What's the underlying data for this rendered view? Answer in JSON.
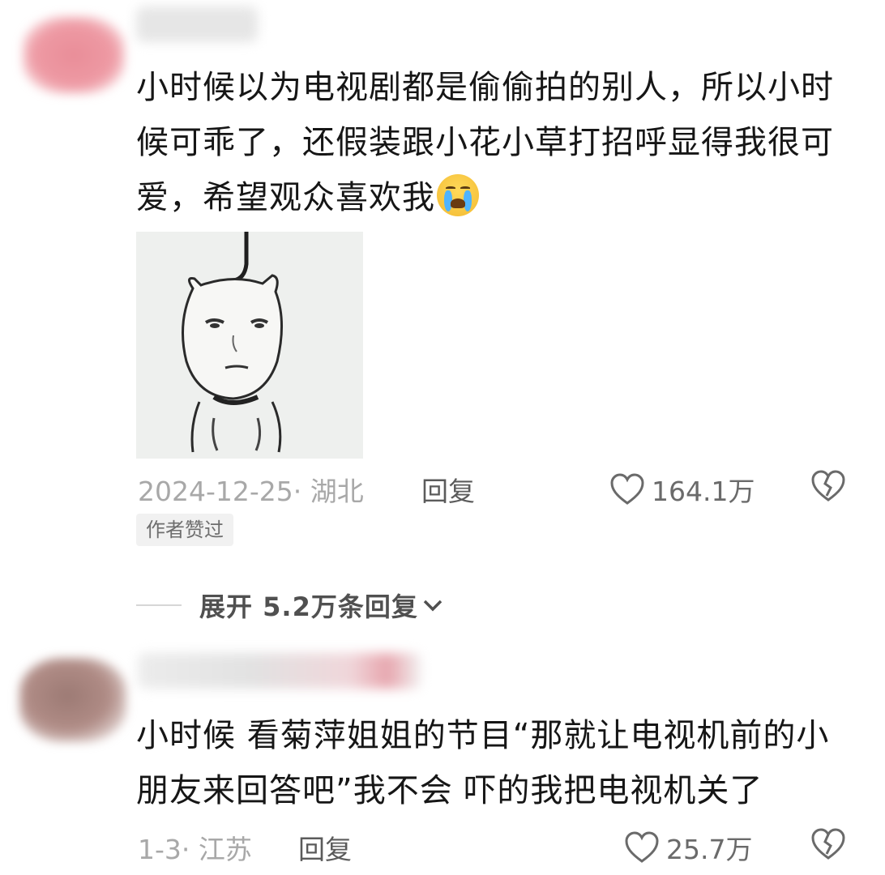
{
  "comments": [
    {
      "text": "小时候以为电视剧都是偷偷拍的别人，所以小时候可乖了，还假装跟小花小草打招呼显得我很可爱，希望观众喜欢我",
      "emoji": "loudly-crying-face",
      "date_location": "2024-12-25· 湖北",
      "reply_label": "回复",
      "likes": "164.1万",
      "author_badge": "作者赞过",
      "expand_replies": "展开 5.2万条回复"
    },
    {
      "text": "小时候 看菊萍姐姐的节目“那就让电视机前的小朋友来回答吧”我不会 吓的我把电视机关了",
      "date_location": "1-3· 江苏",
      "reply_label": "回复",
      "likes": "25.7万"
    }
  ],
  "icons": {
    "like": "heart-outline-icon",
    "dislike": "broken-heart-icon",
    "expand": "chevron-down-icon"
  },
  "colors": {
    "text": "#161616",
    "meta": "#a8a8a8",
    "reply": "#5b5b5b",
    "badge_bg": "#f1f1f1"
  }
}
